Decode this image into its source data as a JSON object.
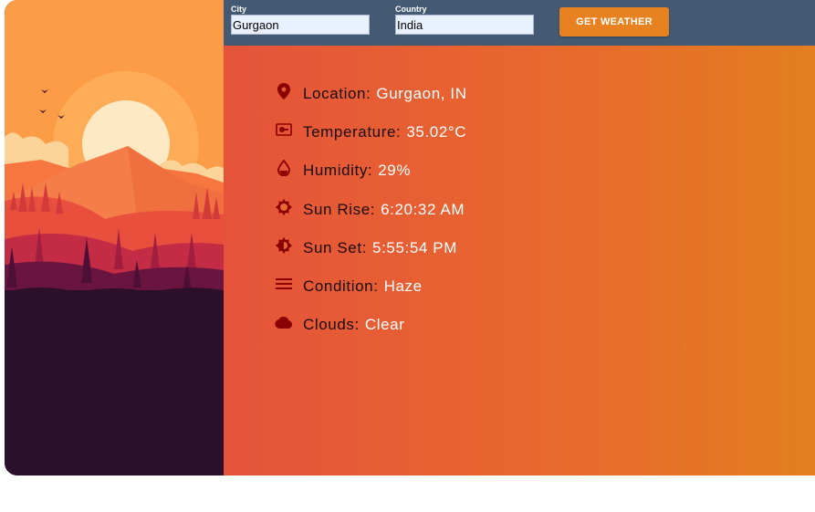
{
  "search": {
    "city_label": "City",
    "city_value": "Gurgaon",
    "country_label": "Country",
    "country_value": "India",
    "button_label": "GET WEATHER"
  },
  "weather": {
    "items": [
      {
        "icon": "location-pin-icon",
        "label": "Location:",
        "value": "Gurgaon, IN"
      },
      {
        "icon": "thermometer-icon",
        "label": "Temperature:",
        "value": "35.02°C"
      },
      {
        "icon": "water-drop-icon",
        "label": "Humidity:",
        "value": "29%"
      },
      {
        "icon": "sun-icon",
        "label": "Sun Rise:",
        "value": "6:20:32 AM"
      },
      {
        "icon": "sunset-icon",
        "label": "Sun Set:",
        "value": "5:55:54 PM"
      },
      {
        "icon": "menu-lines-icon",
        "label": "Condition:",
        "value": "Haze"
      },
      {
        "icon": "cloud-icon",
        "label": "Clouds:",
        "value": "Clear"
      }
    ]
  },
  "colors": {
    "topbar": "#445a73",
    "button": "#e8811f",
    "icon": "#8b0000",
    "value_text": "#ffffff",
    "gradient_start": "#e5533a",
    "gradient_end": "#e37e20",
    "left_panel_base": "#2b0f2b"
  }
}
